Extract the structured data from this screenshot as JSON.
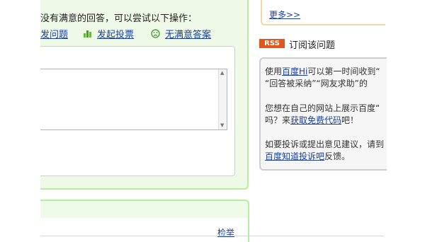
{
  "question_area": {
    "prompt": "没有满意的回答，可以尝试以下操作：",
    "actions": [
      {
        "label": "发问题",
        "icon": "ask-icon"
      },
      {
        "label": "发起投票",
        "icon": "vote-bar-icon"
      },
      {
        "label": "无满意答案",
        "icon": "sad-face-icon"
      }
    ],
    "report_label": "检举"
  },
  "sidebar": {
    "more_label": "更多>>",
    "rss_badge": "RSS",
    "subscribe_label": "订阅该问题",
    "info": {
      "p1_prefix": "使用",
      "p1_link": "百度Hi",
      "p1_rest": "可以第一时间收到“",
      "p1_line2": "“回答被采纳”“网友求助”的",
      "p2_line1": "您想在自己的网站上展示百度“",
      "p2_prefix": "吗？来",
      "p2_link": "获取免费代码",
      "p2_suffix": "吧！",
      "p3_line1": "如要投诉或提出意见建议，请到",
      "p3_link": "百度知道投诉吧",
      "p3_suffix": "反馈。"
    }
  },
  "colors": {
    "link": "#1a3f9e",
    "green_border": "#b8ec9f",
    "rss": "#e3561b",
    "orange_border": "#f3d8a4"
  }
}
